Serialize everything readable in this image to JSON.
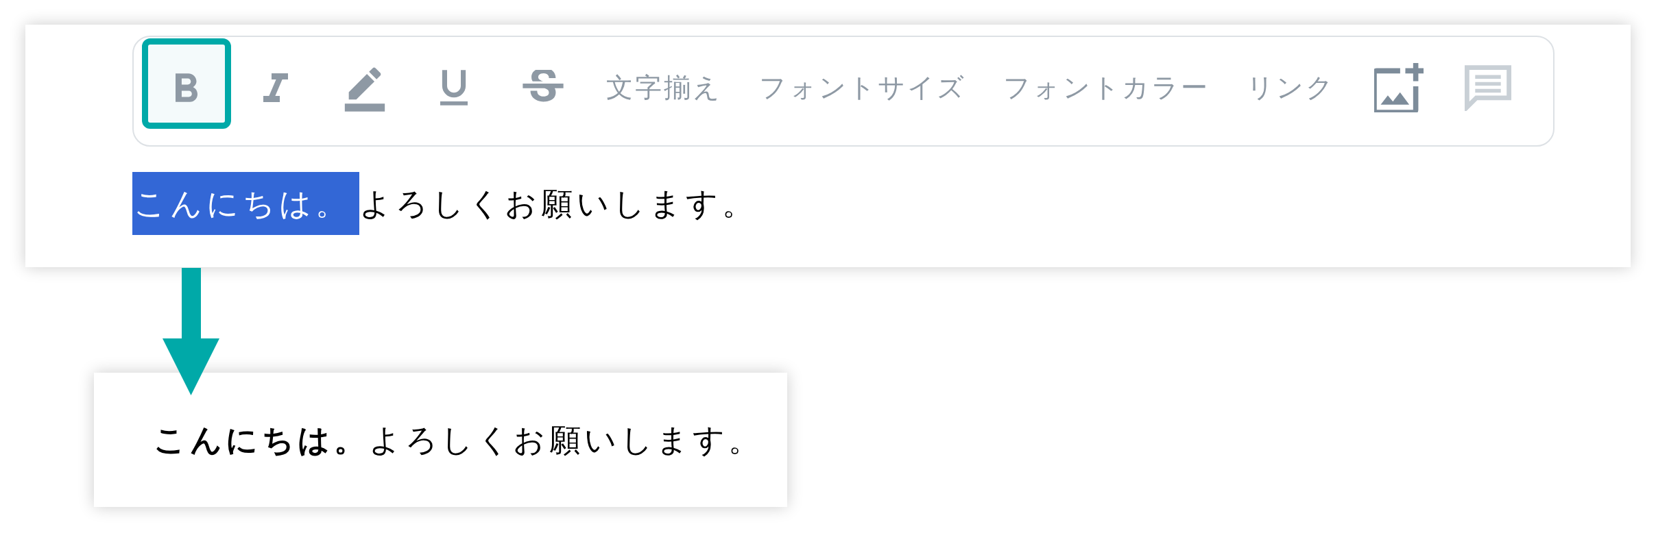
{
  "toolbar": {
    "items": [
      {
        "kind": "bold",
        "selected": true,
        "disabled": false
      },
      {
        "kind": "italic",
        "selected": false,
        "disabled": false
      },
      {
        "kind": "pen",
        "selected": false,
        "disabled": false
      },
      {
        "kind": "underline",
        "selected": false,
        "disabled": false
      },
      {
        "kind": "strike",
        "selected": false,
        "disabled": false
      },
      {
        "kind": "text",
        "label": "文字揃え",
        "selected": false,
        "disabled": false
      },
      {
        "kind": "text",
        "label": "フォントサイズ",
        "selected": false,
        "disabled": false
      },
      {
        "kind": "text",
        "label": "フォントカラー",
        "selected": false,
        "disabled": false
      },
      {
        "kind": "text",
        "label": "リンク",
        "selected": false,
        "disabled": false
      },
      {
        "kind": "image",
        "selected": false,
        "disabled": false
      },
      {
        "kind": "comment",
        "selected": false,
        "disabled": true
      }
    ]
  },
  "editor": {
    "segments": [
      {
        "text": "こんにちは。",
        "selected": true
      },
      {
        "text": "よろしくお願いします。",
        "selected": false
      }
    ]
  },
  "result": {
    "text": "**こんにちは。**よろしくお願いします。"
  }
}
